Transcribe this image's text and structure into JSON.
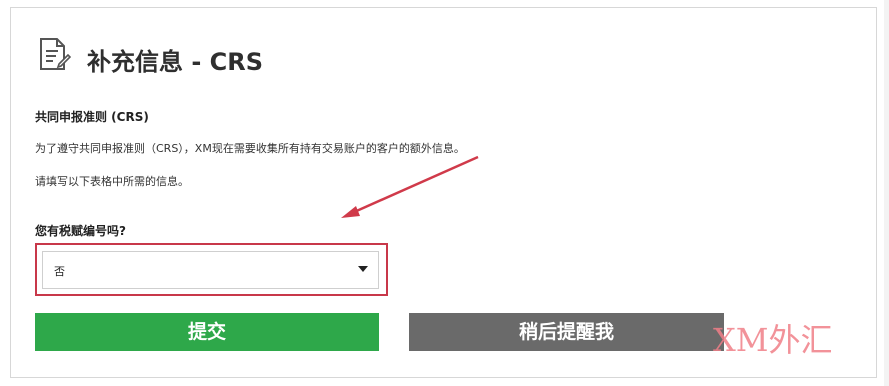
{
  "header": {
    "icon": "document-edit-icon",
    "title": "补充信息 - CRS"
  },
  "section": {
    "title": "共同申报准则 (CRS)",
    "paragraph1": "为了遵守共同申报准则（CRS），XM现在需要收集所有持有交易账户的客户的额外信息。",
    "paragraph2": "请填写以下表格中所需的信息。"
  },
  "form": {
    "question": "您有税赋编号吗?",
    "select_value": "否"
  },
  "buttons": {
    "submit": "提交",
    "later": "稍后提醒我"
  },
  "watermark": "XM外汇",
  "colors": {
    "submit": "#2ea84a",
    "later": "#6a6a6a",
    "annotation": "#d03a4a"
  }
}
